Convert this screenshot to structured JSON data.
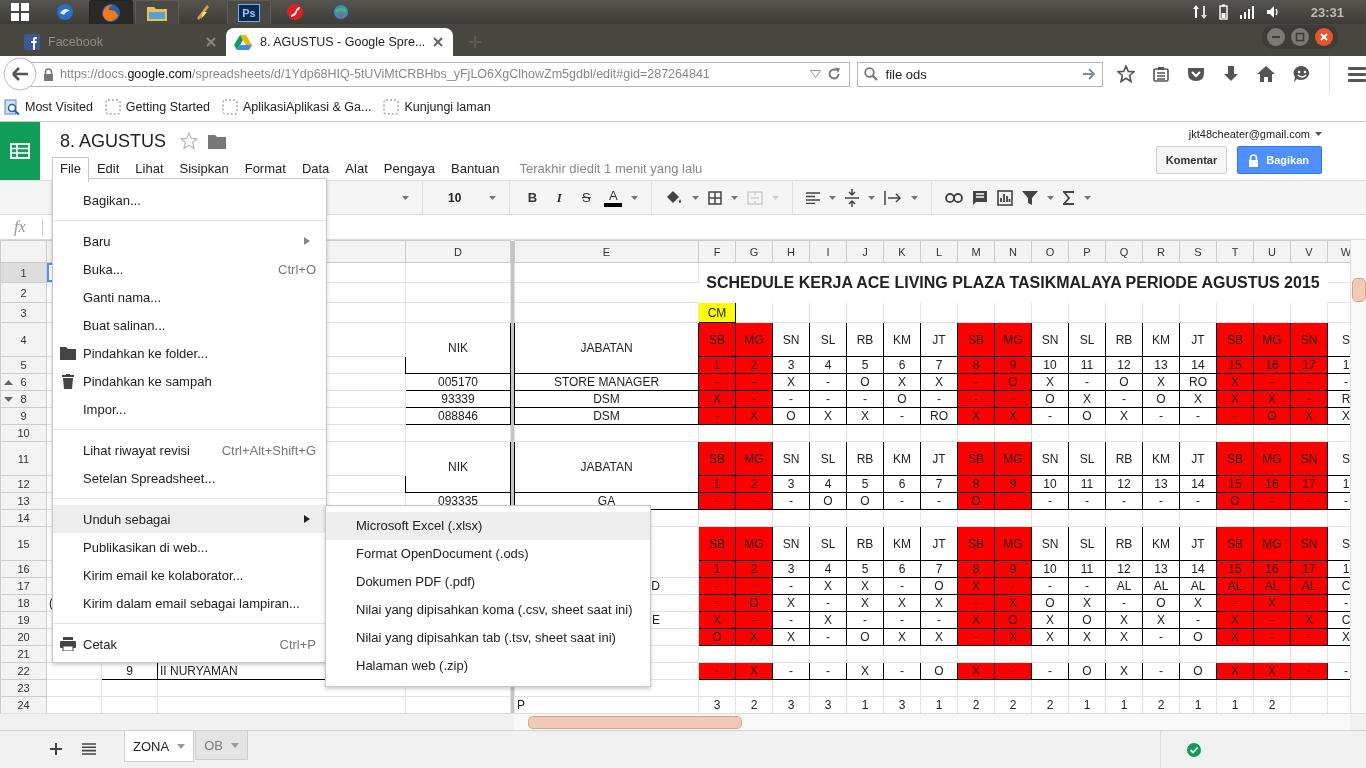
{
  "taskbar": {
    "apps": [
      {
        "kind": "bird",
        "running": false,
        "selected": false
      },
      {
        "kind": "fox",
        "running": true,
        "selected": true
      },
      {
        "kind": "folder",
        "running": true,
        "selected": false
      },
      {
        "kind": "bolt",
        "running": false,
        "selected": false
      },
      {
        "kind": "ps",
        "label": "Ps",
        "running": true,
        "selected": false
      },
      {
        "kind": "flash",
        "running": false,
        "selected": false
      },
      {
        "kind": "globe",
        "running": false,
        "selected": false
      }
    ],
    "clock": "23:31"
  },
  "browser_tabs": [
    {
      "title": "Facebook",
      "kind": "facebook",
      "selected": false
    },
    {
      "title": "8. AGUSTUS - Google Spre...",
      "kind": "drive",
      "selected": true
    }
  ],
  "address_bar": {
    "url": [
      {
        "text": "https://docs.",
        "strong": false
      },
      {
        "text": "google.com",
        "strong": true
      },
      {
        "text": "/spreadsheets/d/1Ydp68HIQ-5tUViMtCRBHbs_yFjLO6XgClhowZm5gdbl/edit#gid=287264841",
        "strong": false
      }
    ]
  },
  "search_field": {
    "value": "file ods"
  },
  "bookmarks": [
    {
      "label": "Most Visited",
      "kind": "special"
    },
    {
      "label": "Getting Started",
      "kind": "page"
    },
    {
      "label": "AplikasiAplikasi & Ga...",
      "kind": "page"
    },
    {
      "label": "Kunjungi laman",
      "kind": "page"
    }
  ],
  "document": {
    "title": "8. AGUSTUS",
    "starred": false,
    "account": "jkt48cheater@gmail.com",
    "comment_button": "Komentar",
    "share_button": "Bagikan",
    "last_edit": "Terakhir diedit 1 menit yang lalu"
  },
  "menu_bar": [
    {
      "label": "File",
      "selected": true
    },
    {
      "label": "Edit",
      "selected": false
    },
    {
      "label": "Lihat",
      "selected": false
    },
    {
      "label": "Sisipkan",
      "selected": false
    },
    {
      "label": "Format",
      "selected": false
    },
    {
      "label": "Data",
      "selected": false
    },
    {
      "label": "Alat",
      "selected": false
    },
    {
      "label": "Pengaya",
      "selected": false
    },
    {
      "label": "Bantuan",
      "selected": false
    }
  ],
  "toolbar": {
    "font_size": "10",
    "format_buttons": [
      {
        "label": "B",
        "kind": "bold"
      },
      {
        "label": "I",
        "kind": "italic"
      },
      {
        "label": "S",
        "kind": "strike"
      },
      {
        "label": "A",
        "kind": "color"
      }
    ]
  },
  "formula_bar": {
    "label": "fx"
  },
  "frozen_columns": [
    {
      "label": "D"
    },
    {
      "label": "E"
    }
  ],
  "day_columns": [
    {
      "label": "F",
      "holiday": true
    },
    {
      "label": "G",
      "holiday": true
    },
    {
      "label": "H",
      "holiday": false
    },
    {
      "label": "I",
      "holiday": false
    },
    {
      "label": "J",
      "holiday": false
    },
    {
      "label": "K",
      "holiday": false
    },
    {
      "label": "L",
      "holiday": false
    },
    {
      "label": "M",
      "holiday": true
    },
    {
      "label": "N",
      "holiday": true
    },
    {
      "label": "O",
      "holiday": false
    },
    {
      "label": "P",
      "holiday": false
    },
    {
      "label": "Q",
      "holiday": false
    },
    {
      "label": "R",
      "holiday": false
    },
    {
      "label": "S",
      "holiday": false
    },
    {
      "label": "T",
      "holiday": true
    },
    {
      "label": "U",
      "holiday": true
    },
    {
      "label": "V",
      "holiday": true
    },
    {
      "label": "W",
      "holiday": false
    }
  ],
  "rows": [
    {
      "label": "1",
      "selected": true,
      "fold_up": false,
      "fold_down": false,
      "kind": "title",
      "title": "SCHEDULE KERJA ACE LIVING PLAZA TASIKMALAYA PERIODE AGUSTUS 2015"
    },
    {
      "label": "2",
      "selected": false,
      "fold_up": false,
      "fold_down": false,
      "kind": "title-cont"
    },
    {
      "label": "3",
      "selected": false,
      "fold_up": false,
      "fold_down": false,
      "kind": "marker",
      "days": [
        "CM"
      ]
    },
    {
      "label": "4",
      "selected": false,
      "fold_up": false,
      "fold_down": false,
      "kind": "header",
      "d": "NIK",
      "e": "JABATAN",
      "days": [
        "SB",
        "MG",
        "SN",
        "SL",
        "RB",
        "KM",
        "JT",
        "SB",
        "MG",
        "SN",
        "SL",
        "RB",
        "KM",
        "JT",
        "SB",
        "MG",
        "SN",
        "S"
      ]
    },
    {
      "label": "5",
      "selected": false,
      "fold_up": false,
      "fold_down": false,
      "kind": "header-cont",
      "days": [
        "1",
        "2",
        "3",
        "4",
        "5",
        "6",
        "7",
        "8",
        "9",
        "10",
        "11",
        "12",
        "13",
        "14",
        "15",
        "16",
        "17",
        "1"
      ]
    },
    {
      "label": "6",
      "selected": false,
      "fold_up": true,
      "fold_down": false,
      "kind": "schedule",
      "d": "005170",
      "e": "STORE MANAGER",
      "days": [
        "-",
        "-",
        "X",
        "-",
        "O",
        "X",
        "X",
        "-",
        "O",
        "X",
        "-",
        "O",
        "X",
        "RO",
        "X",
        "-",
        "-",
        "-"
      ]
    },
    {
      "label": "8",
      "selected": false,
      "fold_up": false,
      "fold_down": true,
      "kind": "schedule",
      "d": "93339",
      "e": "DSM",
      "days": [
        "X",
        "-",
        "-",
        "-",
        "-",
        "O",
        "-",
        "-",
        "-",
        "O",
        "X",
        "-",
        "O",
        "X",
        "X",
        "X",
        "-",
        "R"
      ]
    },
    {
      "label": "9",
      "selected": false,
      "fold_up": false,
      "fold_down": false,
      "kind": "schedule",
      "d": "088846",
      "e": "DSM",
      "days": [
        "-",
        "X",
        "O",
        "X",
        "X",
        "-",
        "RO",
        "X",
        "X",
        "-",
        "O",
        "X",
        "-",
        "-",
        "-",
        "O",
        "X",
        "X"
      ]
    },
    {
      "label": "10",
      "selected": false,
      "fold_up": false,
      "fold_down": false,
      "kind": "plain"
    },
    {
      "label": "11",
      "selected": false,
      "fold_up": false,
      "fold_down": false,
      "kind": "header",
      "d": "NIK",
      "e": "JABATAN",
      "days": [
        "SB",
        "MG",
        "SN",
        "SL",
        "RB",
        "KM",
        "JT",
        "SB",
        "MG",
        "SN",
        "SL",
        "RB",
        "KM",
        "JT",
        "SB",
        "MG",
        "SN",
        "S"
      ]
    },
    {
      "label": "12",
      "selected": false,
      "fold_up": false,
      "fold_down": false,
      "kind": "header-cont",
      "days": [
        "1",
        "2",
        "3",
        "4",
        "5",
        "6",
        "7",
        "8",
        "9",
        "10",
        "11",
        "12",
        "13",
        "14",
        "15",
        "16",
        "17",
        "1"
      ]
    },
    {
      "label": "13",
      "selected": false,
      "fold_up": false,
      "fold_down": false,
      "kind": "schedule",
      "d": "093335",
      "e": "GA",
      "days": [
        "-",
        "-",
        "-",
        "O",
        "O",
        "-",
        "-",
        "O",
        "-",
        "-",
        "-",
        "-",
        "-",
        "-",
        "O",
        "-",
        "-",
        "-"
      ]
    },
    {
      "label": "14",
      "selected": false,
      "fold_up": false,
      "fold_down": false,
      "kind": "plain"
    },
    {
      "label": "15",
      "selected": false,
      "fold_up": false,
      "fold_down": false,
      "kind": "header",
      "days": [
        "SB",
        "MG",
        "SN",
        "SL",
        "RB",
        "KM",
        "JT",
        "SB",
        "MG",
        "SN",
        "SL",
        "RB",
        "KM",
        "JT",
        "SB",
        "MG",
        "SN",
        "S"
      ]
    },
    {
      "label": "16",
      "selected": false,
      "fold_up": false,
      "fold_down": false,
      "kind": "header-cont",
      "days": [
        "1",
        "2",
        "3",
        "4",
        "5",
        "6",
        "7",
        "8",
        "9",
        "10",
        "11",
        "12",
        "13",
        "14",
        "15",
        "16",
        "17",
        "1"
      ]
    },
    {
      "label": "17",
      "selected": false,
      "fold_up": false,
      "fold_down": false,
      "kind": "schedule",
      "e": "D",
      "days": [
        "-",
        "-",
        "-",
        "X",
        "X",
        "-",
        "O",
        "X",
        "-",
        "-",
        "-",
        "AL",
        "AL",
        "AL",
        "AL",
        "AL",
        "AL",
        "C"
      ]
    },
    {
      "label": "18",
      "selected": false,
      "fold_up": false,
      "fold_down": false,
      "kind": "schedule",
      "a": "(",
      "days": [
        "-",
        "O",
        "X",
        "-",
        "X",
        "X",
        "X",
        "-",
        "X",
        "O",
        "X",
        "-",
        "O",
        "X",
        "-",
        "X",
        "-",
        "-"
      ]
    },
    {
      "label": "19",
      "selected": false,
      "fold_up": false,
      "fold_down": false,
      "kind": "schedule",
      "e": "E",
      "days": [
        "X",
        "-",
        "-",
        "X",
        "-",
        "-",
        "-",
        "X",
        "O",
        "X",
        "O",
        "X",
        "X",
        "-",
        "X",
        "-",
        "X",
        "C"
      ]
    },
    {
      "label": "20",
      "selected": false,
      "fold_up": false,
      "fold_down": false,
      "kind": "schedule",
      "days": [
        "O",
        "X",
        "X",
        "-",
        "O",
        "X",
        "X",
        "-",
        "X",
        "X",
        "X",
        "X",
        "-",
        "O",
        "X",
        "-",
        "-",
        "X"
      ]
    },
    {
      "label": "21",
      "selected": false,
      "fold_up": false,
      "fold_down": false,
      "kind": "plain"
    },
    {
      "label": "22",
      "selected": false,
      "fold_up": false,
      "fold_down": false,
      "kind": "schedule",
      "b": "9",
      "c": "II NURYAMAN",
      "days": [
        "-",
        "X",
        "-",
        "-",
        "X",
        "-",
        "O",
        "X",
        "-",
        "-",
        "O",
        "X",
        "-",
        "O",
        "X",
        "X",
        "-",
        "-"
      ]
    },
    {
      "label": "23",
      "selected": false,
      "fold_up": false,
      "fold_down": false,
      "kind": "plain"
    },
    {
      "label": "24",
      "selected": false,
      "fold_up": false,
      "fold_down": false,
      "kind": "plain",
      "e": "P",
      "days": [
        "3",
        "2",
        "3",
        "3",
        "1",
        "3",
        "1",
        "2",
        "2",
        "2",
        "1",
        "1",
        "2",
        "1",
        "1",
        "2"
      ]
    }
  ],
  "file_menu": {
    "sections": [
      {
        "items": [
          {
            "label": "Bagikan...",
            "kind": "plain",
            "selected": false
          }
        ]
      },
      {
        "items": [
          {
            "label": "Baru",
            "kind": "submenu",
            "selected": false
          },
          {
            "label": "Buka...",
            "kind": "plain",
            "shortcut": "Ctrl+O",
            "selected": false
          },
          {
            "label": "Ganti nama...",
            "kind": "plain",
            "selected": false
          },
          {
            "label": "Buat salinan...",
            "kind": "plain",
            "selected": false
          },
          {
            "label": "Pindahkan ke folder...",
            "kind": "folder",
            "selected": false
          },
          {
            "label": "Pindahkan ke sampah",
            "kind": "trash",
            "selected": false
          },
          {
            "label": "Impor...",
            "kind": "plain",
            "selected": false
          }
        ]
      },
      {
        "items": [
          {
            "label": "Lihat riwayat revisi",
            "kind": "plain",
            "shortcut": "Ctrl+Alt+Shift+G",
            "selected": false
          },
          {
            "label": "Setelan Spreadsheet...",
            "kind": "plain",
            "selected": false
          }
        ]
      },
      {
        "items": [
          {
            "label": "Unduh sebagai",
            "kind": "submenu",
            "selected": true
          },
          {
            "label": "Publikasikan di web...",
            "kind": "plain",
            "selected": false
          },
          {
            "label": "Kirim email ke kolaborator...",
            "kind": "plain",
            "selected": false
          },
          {
            "label": "Kirim dalam email sebagai lampiran...",
            "kind": "plain",
            "selected": false
          }
        ]
      },
      {
        "items": [
          {
            "label": "Cetak",
            "kind": "print",
            "shortcut": "Ctrl+P",
            "selected": false
          }
        ]
      }
    ]
  },
  "download_menu": [
    {
      "label": "Microsoft Excel (.xlsx)",
      "selected": true
    },
    {
      "label": "Format OpenDocument (.ods)",
      "selected": false
    },
    {
      "label": "Dokumen PDF (.pdf)",
      "selected": false
    },
    {
      "label": "Nilai yang dipisahkan koma (.csv, sheet saat ini)",
      "selected": false
    },
    {
      "label": "Nilai yang dipisahkan tab (.tsv, sheet saat ini)",
      "selected": false
    },
    {
      "label": "Halaman web (.zip)",
      "selected": false
    }
  ],
  "sheet_tabs": [
    {
      "label": "ZONA",
      "selected": true
    },
    {
      "label": "OB",
      "selected": false
    }
  ],
  "status": {
    "saved": true
  }
}
